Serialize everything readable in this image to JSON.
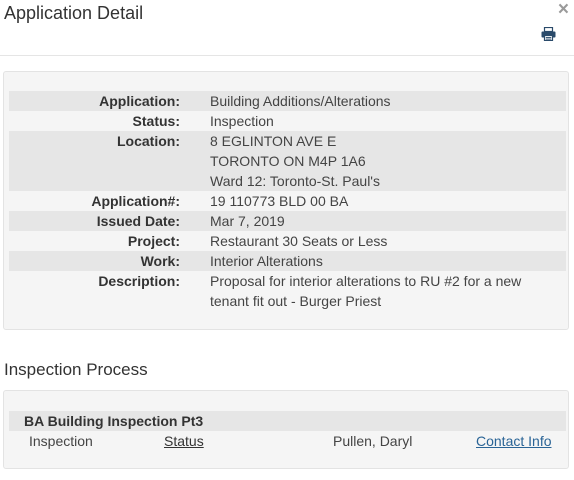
{
  "modal": {
    "title": "Application Detail",
    "close_glyph": "×",
    "print_icon": "printer-icon"
  },
  "details": [
    {
      "label": "Application:",
      "lines": [
        "Building Additions/Alterations"
      ]
    },
    {
      "label": "Status:",
      "lines": [
        "Inspection"
      ]
    },
    {
      "label": "Location:",
      "lines": [
        "8 EGLINTON AVE E",
        "TORONTO ON M4P 1A6",
        "Ward 12: Toronto-St. Paul's"
      ]
    },
    {
      "label": "Application#:",
      "lines": [
        "19 110773 BLD 00 BA"
      ]
    },
    {
      "label": "Issued Date:",
      "lines": [
        "Mar 7, 2019"
      ]
    },
    {
      "label": "Project:",
      "lines": [
        "Restaurant 30 Seats or Less"
      ]
    },
    {
      "label": "Work:",
      "lines": [
        "Interior Alterations"
      ]
    },
    {
      "label": "Description:",
      "lines": [
        "Proposal for interior alterations to RU #2 for a new",
        "tenant fit out - Burger Priest"
      ]
    }
  ],
  "inspection": {
    "section_title": "Inspection Process",
    "group_title": "BA Building Inspection Pt3",
    "row": {
      "type": "Inspection",
      "status_link": "Status",
      "inspector": "Pullen, Daryl",
      "contact_link": "Contact Info"
    }
  },
  "colors": {
    "row_shade": "#e6e6e6",
    "well_bg": "#f5f5f5",
    "link": "#2a6496"
  }
}
